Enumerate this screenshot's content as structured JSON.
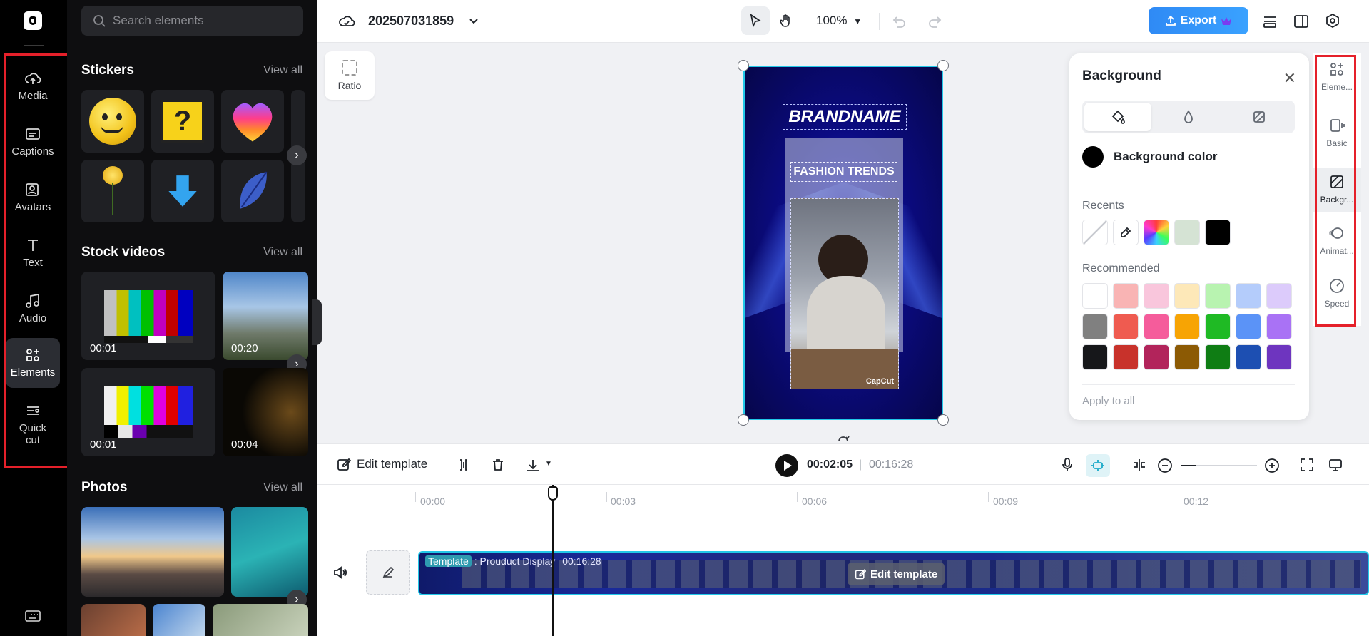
{
  "rail": {
    "items": [
      {
        "label": "Media",
        "icon": "cloud-upload-icon"
      },
      {
        "label": "Captions",
        "icon": "captions-icon"
      },
      {
        "label": "Avatars",
        "icon": "avatar-icon"
      },
      {
        "label": "Text",
        "icon": "text-icon"
      },
      {
        "label": "Audio",
        "icon": "music-note-icon"
      },
      {
        "label": "Elements",
        "icon": "elements-icon",
        "active": true
      },
      {
        "label": "Quick cut",
        "icon": "quick-cut-icon"
      }
    ]
  },
  "panel": {
    "search_placeholder": "Search elements",
    "stickers": {
      "title": "Stickers",
      "view_all": "View all"
    },
    "stock_videos": {
      "title": "Stock videos",
      "view_all": "View all",
      "durations": [
        "00:01",
        "00:20",
        "00:01",
        "00:04"
      ]
    },
    "photos": {
      "title": "Photos",
      "view_all": "View all"
    }
  },
  "topbar": {
    "project_title": "202507031859",
    "zoom": "100%",
    "export_label": "Export"
  },
  "canvas": {
    "ratio_label": "Ratio",
    "brandname": "BRANDNAME",
    "fashion": "FASHION TRENDS",
    "watermark": "CapCut"
  },
  "background_panel": {
    "title": "Background",
    "bg_color_label": "Background color",
    "recents_label": "Recents",
    "recommended_label": "Recommended",
    "apply_all": "Apply to all",
    "recents": [
      "none",
      "eyedropper",
      "rainbow",
      "#d5e3d4",
      "#000000"
    ],
    "recommended": [
      [
        "#ffffff",
        "#f9b4b4",
        "#f9c6dc",
        "#fde8b8",
        "#b8f3b0",
        "#b4ccfb",
        "#dccbfb"
      ],
      [
        "#808080",
        "#ef5b50",
        "#f55c9b",
        "#f7a404",
        "#1fba24",
        "#5b93f7",
        "#a972f5"
      ],
      [
        "#16171a",
        "#c8322b",
        "#b2245b",
        "#8c5a04",
        "#0f7d14",
        "#1d4fb2",
        "#6e35bf"
      ]
    ]
  },
  "right_rail": {
    "items": [
      {
        "label": "Eleme...",
        "icon": "elements-icon"
      },
      {
        "label": "Basic",
        "icon": "basic-icon"
      },
      {
        "label": "Backgr...",
        "icon": "background-icon",
        "active": true
      },
      {
        "label": "Animat...",
        "icon": "animation-icon"
      },
      {
        "label": "Speed",
        "icon": "speed-icon"
      }
    ]
  },
  "timeline": {
    "edit_template": "Edit template",
    "current_time": "00:02:05",
    "separator": "|",
    "total_time": "00:16:28",
    "ticks": [
      "00:00",
      "00:03",
      "00:06",
      "00:09",
      "00:12"
    ],
    "track_tag": "Template",
    "track_name": ": Prouduct Display",
    "track_duration": "00:16:28",
    "track_edit": "Edit template"
  }
}
